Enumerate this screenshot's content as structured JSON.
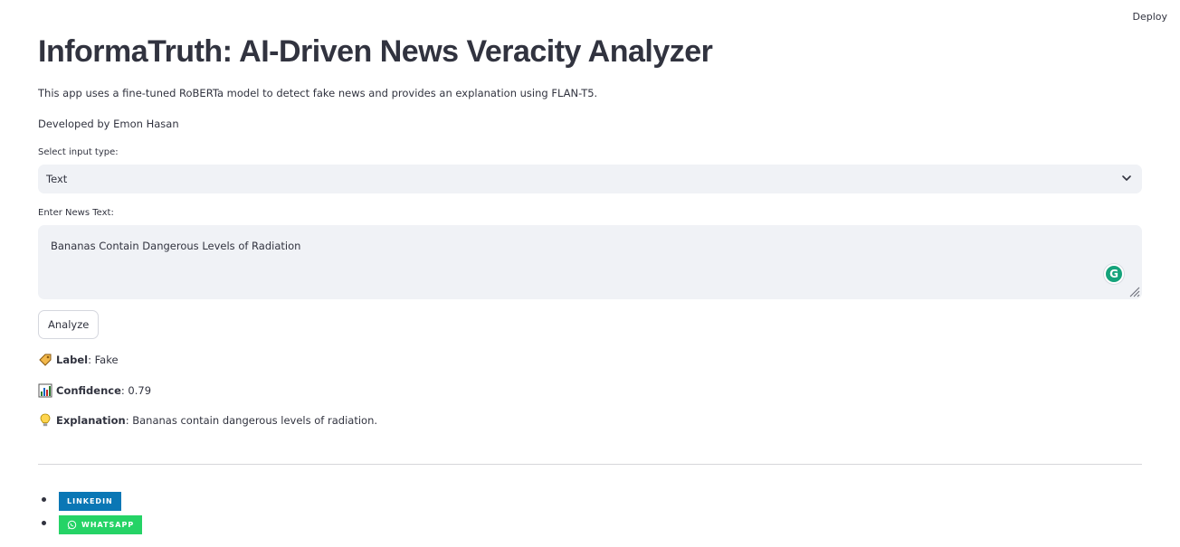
{
  "header": {
    "deploy_label": "Deploy"
  },
  "page": {
    "title": "InformaTruth: AI-Driven News Veracity Analyzer",
    "description": "This app uses a fine-tuned RoBERTa model to detect fake news and provides an explanation using FLAN-T5.",
    "developer": "Developed by Emon Hasan"
  },
  "input_type": {
    "label": "Select input type:",
    "selected": "Text"
  },
  "news_text": {
    "label": "Enter News Text:",
    "value": "Bananas Contain Dangerous Levels of Radiation"
  },
  "analyze_button": {
    "label": "Analyze"
  },
  "results": {
    "label_key": "Label",
    "label_value": ": Fake",
    "confidence_key": "Confidence",
    "confidence_value": ": 0.79",
    "explanation_key": "Explanation",
    "explanation_value": ": Bananas contain dangerous levels of radiation."
  },
  "social_links": [
    {
      "label": "LINKEDIN",
      "icon": "none",
      "color": "#0a77b5"
    },
    {
      "label": "WHATSAPP",
      "icon": "whatsapp-icon",
      "color": "#25d366"
    }
  ],
  "colors": {
    "input_bg": "#f0f2f6",
    "text": "#31333f",
    "grammarly": "#15a37b"
  }
}
